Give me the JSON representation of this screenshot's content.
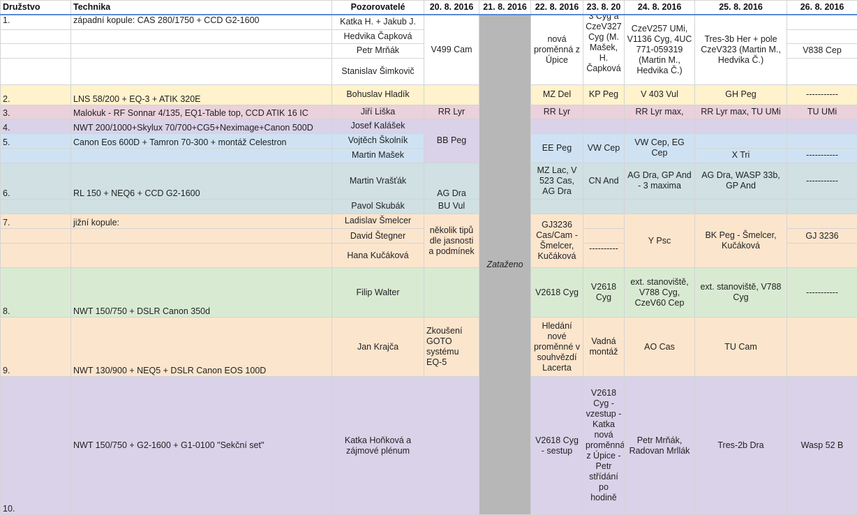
{
  "headers": {
    "druzstvo": "Družstvo",
    "technika": "Technika",
    "pozorovatele": "Pozorovatelé",
    "d20": "20. 8. 2016",
    "d21": "21. 8. 2016",
    "d22": "22. 8. 2016",
    "d23": "23. 8. 20",
    "d24": "24. 8. 2016",
    "d25": "25. 8. 2016",
    "d26": "26. 8. 2016"
  },
  "rows": {
    "r1": {
      "num": "1.",
      "tech": "západní kopule: CAS 280/1750 + CCD G2-1600",
      "obs1": "Katka H. + Jakub J.",
      "obs2": "Hedvika Čapková",
      "obs3": "Petr Mrňák",
      "obs4": "Stanislav Šimkovič",
      "d20": "V499 Cam",
      "d22": "nová proměnná z Úpice",
      "d23": "3 Cyg a CzeV327 Cyg (M. Mašek, H. Čapková",
      "d24": "CzeV257 UMi, V1136 Cyg, 4UC 771-059319 (Martin M., Hedvika Č.)",
      "d25": "Tres-3b Her + pole CzeV323 (Martin M., Hedvika Č.)",
      "d26": "V838 Cep"
    },
    "r2": {
      "num": "2.",
      "tech": "LNS 58/200 + EQ-3 + ATIK 320E",
      "obs": "Bohuslav Hladík",
      "d22": "MZ Del",
      "d23": "KP Peg",
      "d24": "V 403 Vul",
      "d25": "GH Peg",
      "d26": "-----------"
    },
    "r3": {
      "num": "3.",
      "tech": "Malokuk - RF Sonnar 4/135, EQ1-Table top, CCD ATIK 16 IC",
      "obs": "Jiří Liška",
      "d20": "RR Lyr",
      "d22": "RR Lyr",
      "d24": "RR Lyr max,",
      "d25": "RR Lyr max, TU UMi",
      "d26": "TU UMi"
    },
    "r4": {
      "num": "4.",
      "tech": "NWT 200/1000+Skylux 70/700+CG5+Neximage+Canon 500D",
      "obs": "Josef Kalášek"
    },
    "r5": {
      "num": "5.",
      "tech": "Canon Eos 600D + Tamron 70-300 + montáž Celestron",
      "obs1": "Vojtěch Školník",
      "obs2": "Martin Mašek",
      "d20": "BB Peg",
      "d22": "EE Peg",
      "d23": "VW Cep",
      "d24": "VW Cep, EG Cep",
      "d25": "X Tri",
      "d26": "-----------"
    },
    "r6": {
      "num": "6.",
      "tech": "RL 150 + NEQ6 + CCD G2-1600",
      "obs1": "Martin Vrašťák",
      "obs2": "Pavol Skubák",
      "d20a": "AG Dra",
      "d20b": "BU Vul",
      "d22": "MZ Lac, V 523 Cas, AG Dra",
      "d23": "CN And",
      "d24": "AG Dra, GP And - 3 maxima",
      "d25": "AG Dra, WASP 33b, GP And",
      "d26": "-----------"
    },
    "r7": {
      "num": "7.",
      "tech": "jižní kopule:",
      "obs1": "Ladislav Šmelcer",
      "obs2": "David Štegner",
      "obs3": "Hana Kučáková",
      "d20": "několik tipů dle jasnosti a podmínek",
      "d22": "GJ3236 Cas/Cam - Šmelcer, Kučáková",
      "d23": "----------",
      "d24": "Y Psc",
      "d25": "BK Peg - Šmelcer, Kučáková",
      "d26": "GJ 3236"
    },
    "r8": {
      "num": "8.",
      "tech": "NWT 150/750 + DSLR Canon 350d",
      "obs": "Filip Walter",
      "d22": "V2618 Cyg",
      "d23": "V2618 Cyg",
      "d24": "ext. stanoviště, V788 Cyg, CzeV60 Cep",
      "d25": "ext. stanoviště, V788 Cyg",
      "d26": "-----------"
    },
    "r9": {
      "num": "9.",
      "tech": "NWT 130/900 + NEQ5 + DSLR Canon EOS 100D",
      "obs": "Jan Krajča",
      "d20": "Zkoušení GOTO systému EQ-5",
      "d22": "Hledání nové proměnné v souhvězdí Lacerta",
      "d23": "Vadná montáž",
      "d24": "AO Cas",
      "d25": "TU Cam"
    },
    "r10": {
      "num": "10.",
      "tech": "NWT 150/750 + G2-1600 + G1-0100 \"Sekční set\"",
      "obs": "Katka Hoňková a zájmové plénum",
      "d22": "V2618 Cyg - sestup",
      "d23": "V2618 Cyg - vzestup - Katka nová proměnná z Úpice - Petr střídání po hodině",
      "d24": "Petr Mrňák, Radovan Mrllák",
      "d25": "Tres-2b Dra",
      "d26": "Wasp 52 B"
    }
  },
  "overcast": "Zataženo",
  "colors": {
    "header_line": "#5b8ad6",
    "yellow": "#fff2cc",
    "pink": "#ead1dc",
    "lavender": "#d9d2e9",
    "blue": "#cfe2f3",
    "teal": "#d0e0e3",
    "orange": "#fce5cd",
    "green": "#d9ead3",
    "gray": "#b7b7b7"
  }
}
